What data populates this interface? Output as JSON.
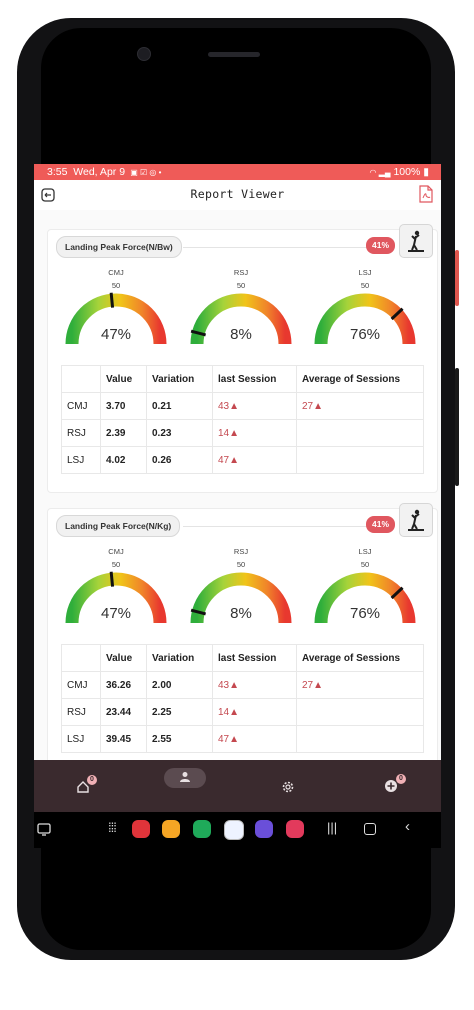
{
  "status": {
    "time": "3:55",
    "date": "Wed, Apr 9",
    "battery": "100%"
  },
  "app": {
    "title": "Report Viewer"
  },
  "cards": [
    {
      "chip": "Landing Peak Force(N/Bw)",
      "percent": "41%",
      "gauges": [
        {
          "label": "CMJ",
          "fifty": "50",
          "value": "47%",
          "level": 0.47
        },
        {
          "label": "RSJ",
          "fifty": "50",
          "value": "8%",
          "level": 0.08
        },
        {
          "label": "LSJ",
          "fifty": "50",
          "value": "76%",
          "level": 0.76
        }
      ],
      "headers": [
        "",
        "Value",
        "Variation",
        "last Session",
        "Average of Sessions"
      ],
      "rows": [
        {
          "name": "CMJ",
          "value": "3.70",
          "variation": "0.21",
          "last": "43▲",
          "avg": "27▲"
        },
        {
          "name": "RSJ",
          "value": "2.39",
          "variation": "0.23",
          "last": "14▲",
          "avg": ""
        },
        {
          "name": "LSJ",
          "value": "4.02",
          "variation": "0.26",
          "last": "47▲",
          "avg": ""
        }
      ]
    },
    {
      "chip": "Landing Peak Force(N/Kg)",
      "percent": "41%",
      "gauges": [
        {
          "label": "CMJ",
          "fifty": "50",
          "value": "47%",
          "level": 0.47
        },
        {
          "label": "RSJ",
          "fifty": "50",
          "value": "8%",
          "level": 0.08
        },
        {
          "label": "LSJ",
          "fifty": "50",
          "value": "76%",
          "level": 0.76
        }
      ],
      "headers": [
        "",
        "Value",
        "Variation",
        "last Session",
        "Average of Sessions"
      ],
      "rows": [
        {
          "name": "CMJ",
          "value": "36.26",
          "variation": "2.00",
          "last": "43▲",
          "avg": "27▲"
        },
        {
          "name": "RSJ",
          "value": "23.44",
          "variation": "2.25",
          "last": "14▲",
          "avg": ""
        },
        {
          "name": "LSJ",
          "value": "39.45",
          "variation": "2.55",
          "last": "47▲",
          "avg": ""
        }
      ]
    }
  ],
  "nav": {
    "home_badge": "0",
    "add_badge": "0"
  },
  "colors": {
    "status_bar": "#ef5b58",
    "nav_bg": "#3a2a2e",
    "badge": "#e0575f"
  }
}
